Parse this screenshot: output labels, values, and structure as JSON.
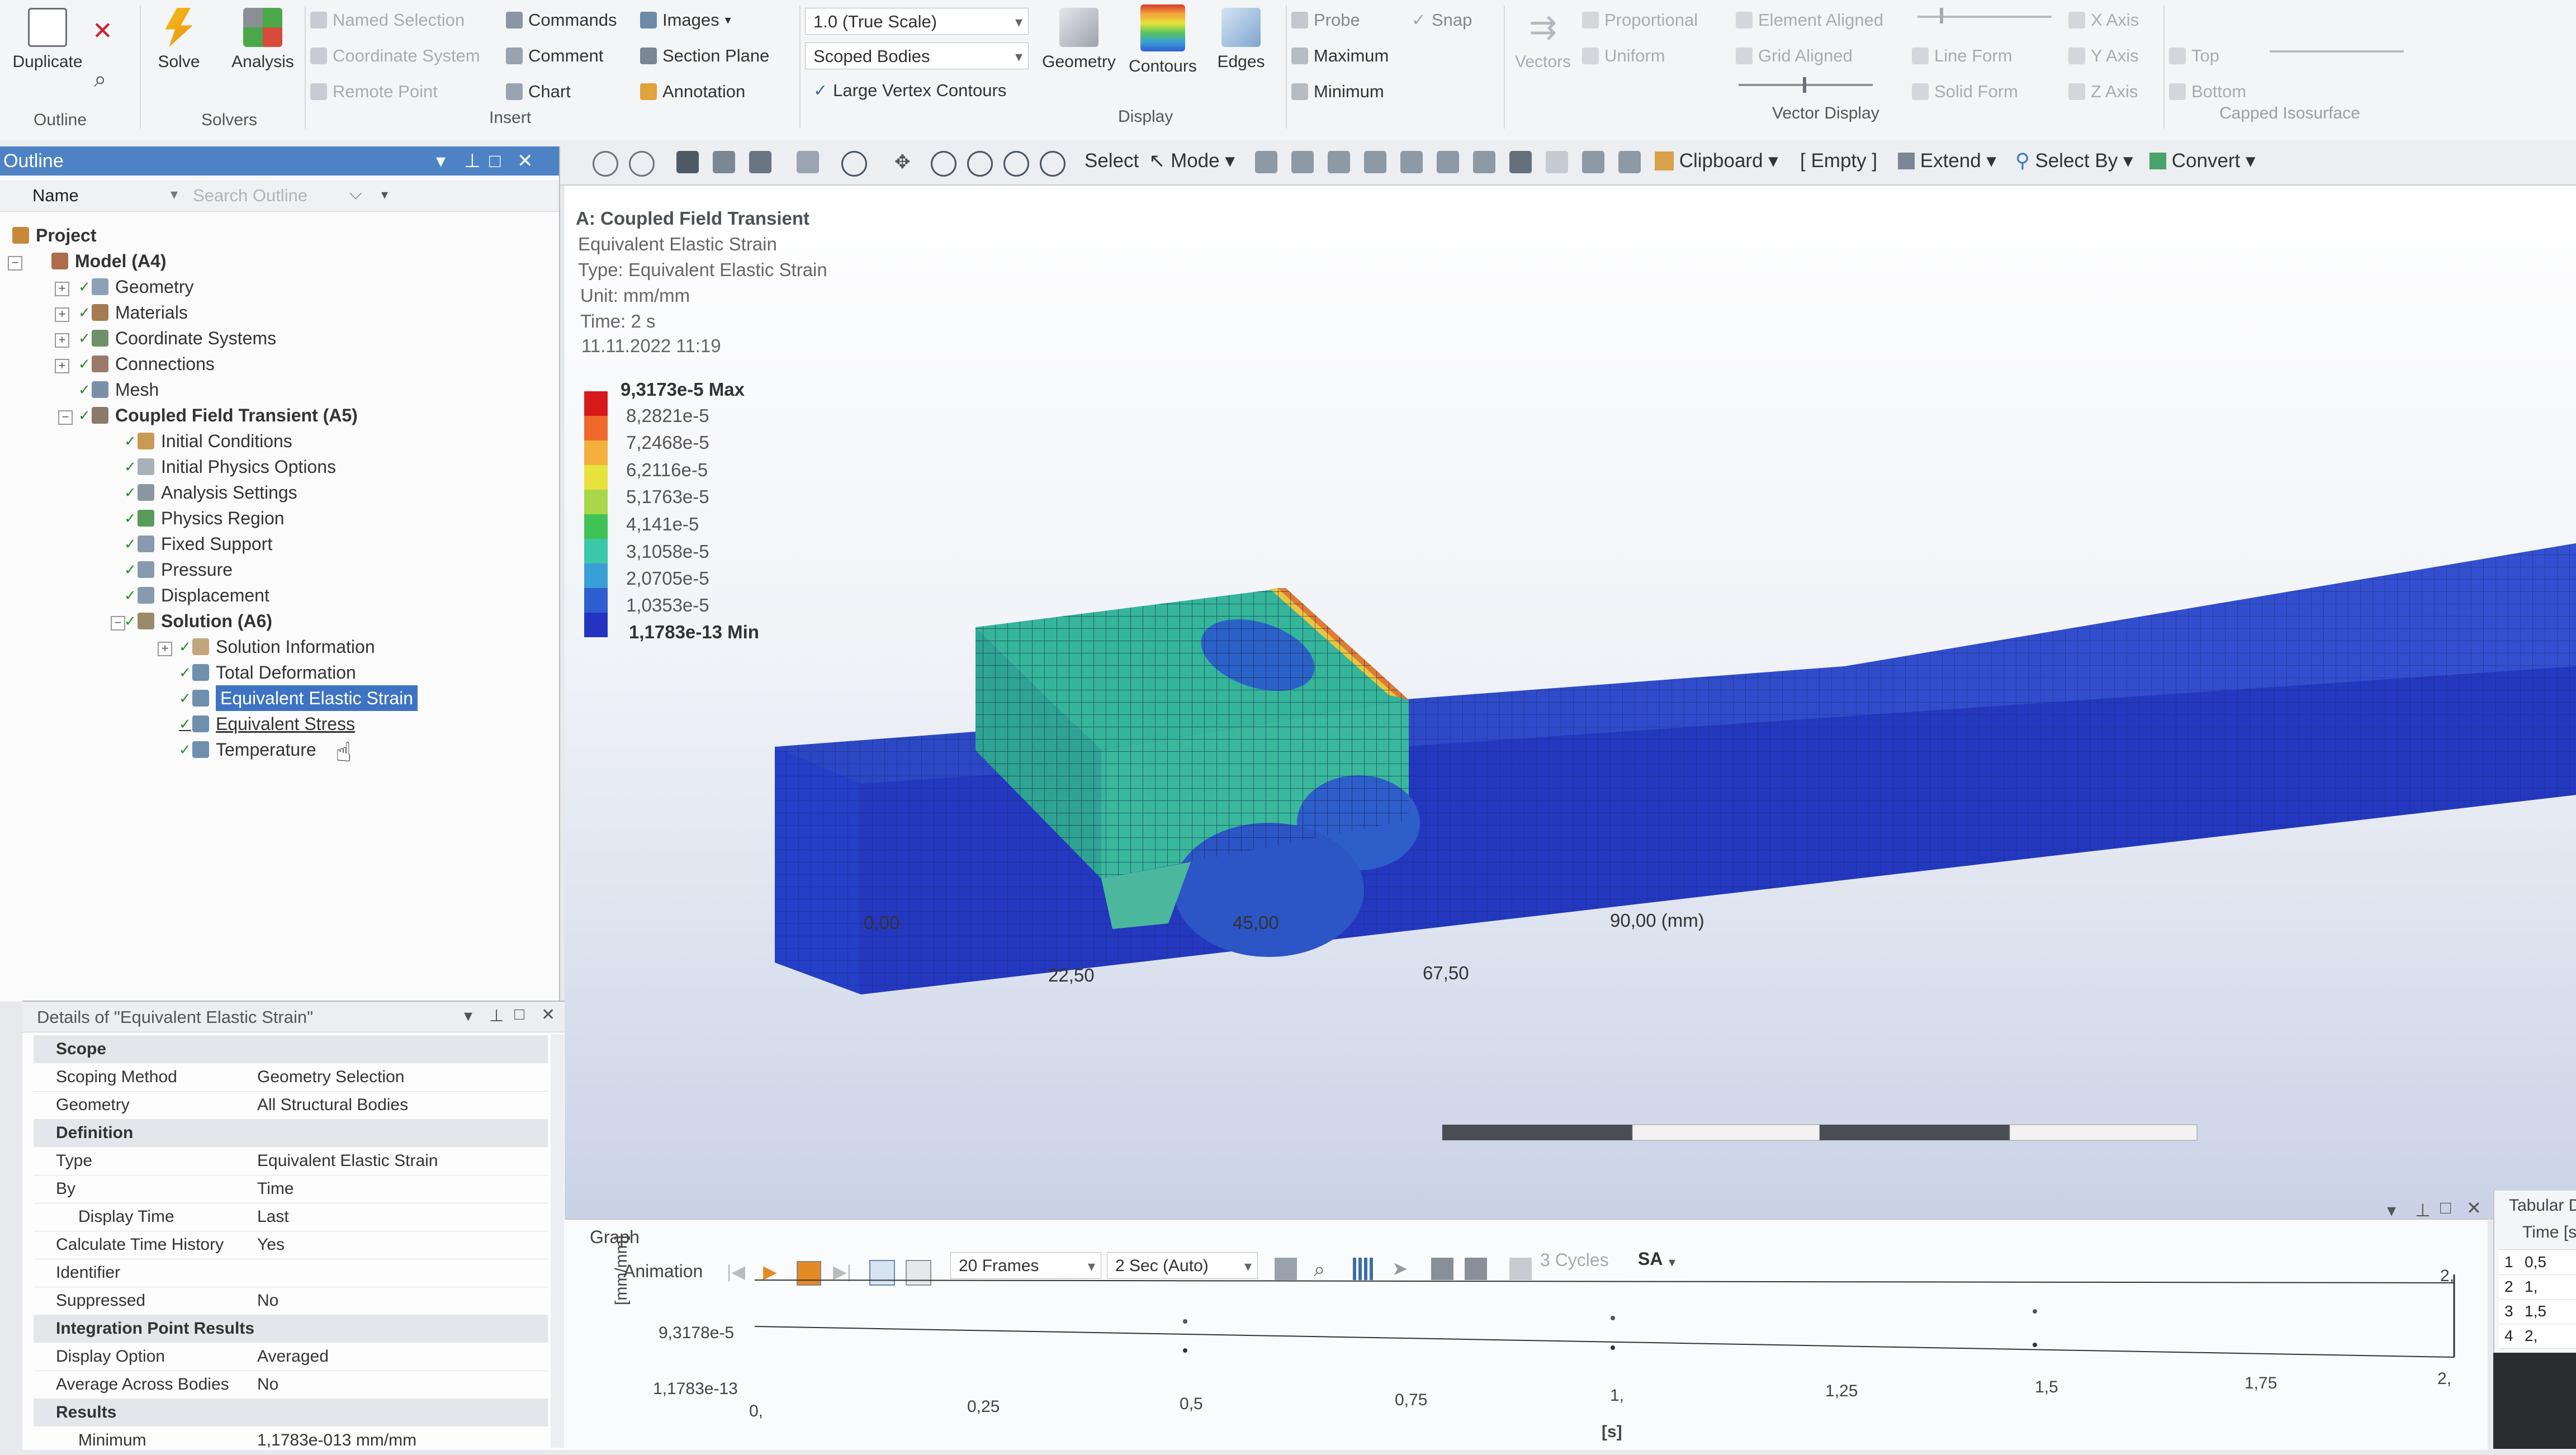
{
  "ribbon": {
    "duplicate": "Duplicate",
    "outline": "Outline",
    "solve": "Solve",
    "analysis": "Analysis",
    "solvers": "Solvers",
    "named_selection": "Named Selection",
    "coordinate_system": "Coordinate System",
    "remote_point": "Remote Point",
    "commands": "Commands",
    "comment": "Comment",
    "chart": "Chart",
    "images": "Images",
    "section_plane": "Section Plane",
    "annotation": "Annotation",
    "insert": "Insert",
    "scale": "1.0 (True Scale)",
    "scoped_bodies": "Scoped Bodies",
    "large_vertex_contours": "Large Vertex Contours",
    "geometry": "Geometry",
    "contours": "Contours",
    "edges": "Edges",
    "display": "Display",
    "probe": "Probe",
    "maximum": "Maximum",
    "minimum": "Minimum",
    "snap": "Snap",
    "vectors": "Vectors",
    "proportional": "Proportional",
    "uniform": "Uniform",
    "element_aligned": "Element Aligned",
    "grid_aligned": "Grid Aligned",
    "line_form": "Line Form",
    "solid_form": "Solid Form",
    "vector_display": "Vector Display",
    "x_axis": "X Axis",
    "y_axis": "Y Axis",
    "z_axis": "Z Axis",
    "top": "Top",
    "bottom": "Bottom",
    "capped_isosurface": "Capped Isosurface"
  },
  "toolbar": {
    "select": "Select",
    "mode": "Mode",
    "clipboard": "Clipboard",
    "empty": "[ Empty ]",
    "extend": "Extend",
    "select_by": "Select By",
    "convert": "Convert"
  },
  "outline": {
    "title": "Outline",
    "name_col": "Name",
    "search_placeholder": "Search Outline",
    "tree": [
      {
        "label": "Project"
      },
      {
        "label": "Model (A4)"
      },
      {
        "label": "Geometry"
      },
      {
        "label": "Materials"
      },
      {
        "label": "Coordinate Systems"
      },
      {
        "label": "Connections"
      },
      {
        "label": "Mesh"
      },
      {
        "label": "Coupled Field Transient (A5)"
      },
      {
        "label": "Initial Conditions"
      },
      {
        "label": "Initial Physics Options"
      },
      {
        "label": "Analysis Settings"
      },
      {
        "label": "Physics Region"
      },
      {
        "label": "Fixed Support"
      },
      {
        "label": "Pressure"
      },
      {
        "label": "Displacement"
      },
      {
        "label": "Solution (A6)"
      },
      {
        "label": "Solution Information"
      },
      {
        "label": "Total Deformation"
      },
      {
        "label": "Equivalent Elastic Strain"
      },
      {
        "label": "Equivalent Stress"
      },
      {
        "label": "Temperature"
      }
    ]
  },
  "details": {
    "title": "Details of \"Equivalent Elastic Strain\"",
    "scope": "Scope",
    "scoping_method_k": "Scoping Method",
    "scoping_method_v": "Geometry Selection",
    "geometry_k": "Geometry",
    "geometry_v": "All Structural Bodies",
    "definition": "Definition",
    "type_k": "Type",
    "type_v": "Equivalent Elastic Strain",
    "by_k": "By",
    "by_v": "Time",
    "display_time_k": "Display Time",
    "display_time_v": "Last",
    "calc_history_k": "Calculate Time History",
    "calc_history_v": "Yes",
    "identifier_k": "Identifier",
    "identifier_v": "",
    "suppressed_k": "Suppressed",
    "suppressed_v": "No",
    "ipr": "Integration Point Results",
    "display_option_k": "Display Option",
    "display_option_v": "Averaged",
    "avg_bodies_k": "Average Across Bodies",
    "avg_bodies_v": "No",
    "results": "Results",
    "minimum_k": "Minimum",
    "minimum_v": "1,1783e-013 mm/mm"
  },
  "viewport": {
    "result_title": "A: Coupled Field Transient",
    "result_name": "Equivalent Elastic Strain",
    "result_type": "Type: Equivalent Elastic Strain",
    "unit": "Unit: mm/mm",
    "time": "Time: 2 s",
    "date": "11.11.2022 11:19",
    "legend": {
      "max_label": "9,3173e-5 Max",
      "values": [
        "8,2821e-5",
        "7,2468e-5",
        "6,2116e-5",
        "5,1763e-5",
        "4,141e-5",
        "3,1058e-5",
        "2,0705e-5",
        "1,0353e-5"
      ],
      "min_label": "1,1783e-13 Min",
      "colors": [
        "#d7191c",
        "#f0692c",
        "#f3b03f",
        "#e7e33c",
        "#a8d84a",
        "#3fc356",
        "#3cc7a8",
        "#3a9fd6",
        "#2f5ed1",
        "#2335c0"
      ]
    },
    "scale_bar": {
      "t0": "0,00",
      "t1": "45,00",
      "t2": "90,00 (mm)",
      "b1": "22,50",
      "b2": "67,50"
    }
  },
  "graph": {
    "title": "Graph",
    "animation": "Animation",
    "frames": "20 Frames",
    "duration": "2 Sec (Auto)",
    "cycles": "3 Cycles",
    "sa": "SA",
    "y_top": "9,3178e-5",
    "y_bottom": "1,1783e-13",
    "y_unit": "[mm/mm]",
    "x_ticks": [
      "0,",
      "0,25",
      "0,5",
      "0,75",
      "1,",
      "1,25",
      "1,5",
      "1,75",
      "2,"
    ],
    "x_unit": "[s]",
    "x_top_right": "2,"
  },
  "tabular": {
    "title": "Tabular D",
    "col": "Time [s",
    "rows": [
      {
        "i": "1",
        "t": "0,5"
      },
      {
        "i": "2",
        "t": "1,"
      },
      {
        "i": "3",
        "t": "1,5"
      },
      {
        "i": "4",
        "t": "2,"
      }
    ]
  }
}
